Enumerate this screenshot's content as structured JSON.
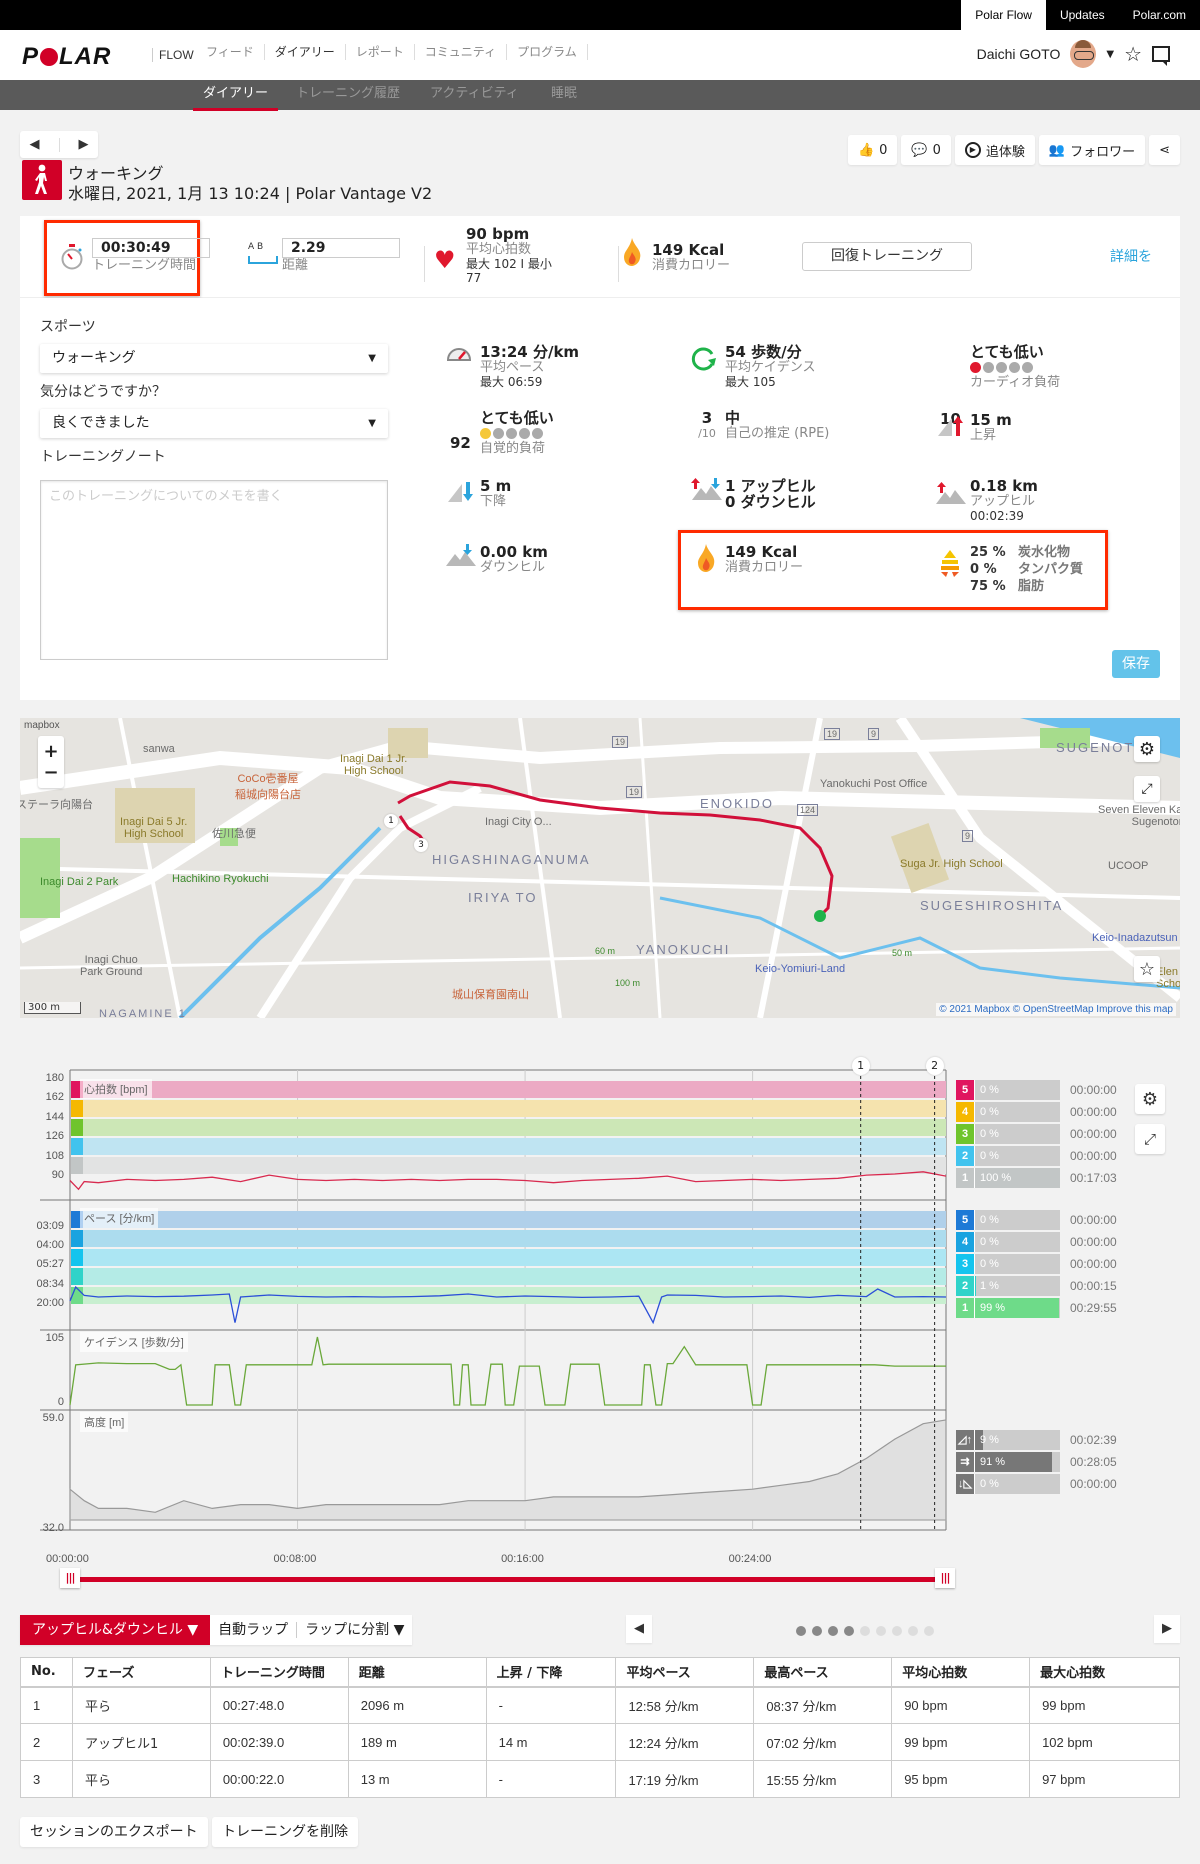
{
  "topbar": {
    "links": [
      "Polar Flow",
      "Updates",
      "Polar.com"
    ],
    "active_index": 0
  },
  "nav": {
    "logo": "POLAR",
    "product": "FLOW",
    "links": [
      "フィード",
      "ダイアリー",
      "レポート",
      "コミュニティ",
      "プログラム"
    ],
    "active_index": 1,
    "user_name": "Daichi GOTO"
  },
  "subnav": {
    "links": [
      "ダイアリー",
      "トレーニング履歴",
      "アクティビティ",
      "睡眠"
    ],
    "active_index": 0
  },
  "session": {
    "sport": "ウォーキング",
    "datetime_device": "水曜日, 2021, 1月 13 10:24 | Polar Vantage V2"
  },
  "actions": {
    "likes": "0",
    "comments": "0",
    "relive": "追体験",
    "followers": "フォロワー"
  },
  "summary": {
    "duration": "00:30:49",
    "duration_label": "トレーニング時間",
    "distance_ab": "A  B",
    "distance": "2.29",
    "distance_label": "距離",
    "hr_avg": "90 bpm",
    "hr_label": "平均心拍数",
    "hr_maxmin": "最大 102 I 最小",
    "hr_min": "77",
    "calories": "149 Kcal",
    "calories_label": "消費カロリー",
    "benefit_button": "回復トレーニング",
    "details_link": "詳細を"
  },
  "form": {
    "sport_label": "スポーツ",
    "sport_value": "ウォーキング",
    "feeling_label": "気分はどうですか？",
    "feeling_value": "良くできました",
    "note_label": "トレーニングノート",
    "note_placeholder": "このトレーニングについてのメモを書く",
    "save": "保存"
  },
  "metrics": {
    "pace": {
      "value": "13:24 分/km",
      "label": "平均ペース",
      "sub": "最大 06:59"
    },
    "cadence": {
      "value": "54 歩数/分",
      "label": "平均ケイデンス",
      "sub": "最大 105"
    },
    "cardio_load": {
      "num": "10",
      "value": "とても低い",
      "label": "カーディオ負荷",
      "level": 1,
      "max": 5,
      "color": "#e0182d"
    },
    "perceived_load": {
      "num": "92",
      "value": "とても低い",
      "label": "自覚的負荷",
      "level": 1,
      "max": 5,
      "color": "#f5c83a"
    },
    "rpe": {
      "num": "3",
      "den": "/10",
      "value": "中",
      "label": "自己の推定 (RPE)"
    },
    "ascent": {
      "value": "15 m",
      "label": "上昇"
    },
    "descent": {
      "value": "5 m",
      "label": "下降"
    },
    "hills": {
      "uphill": "1 アップヒル",
      "downhill": "0 ダウンヒル"
    },
    "uphill_dist": {
      "value": "0.18 km",
      "label": "アップヒル",
      "sub": "00:02:39"
    },
    "downhill_dist": {
      "value": "0.00 km",
      "label": "ダウンヒル"
    },
    "calories": {
      "value": "149 Kcal",
      "label": "消費カロリー"
    },
    "fuel": [
      {
        "pct": "25 %",
        "label": "炭水化物"
      },
      {
        "pct": "0 %",
        "label": "タンパク質"
      },
      {
        "pct": "75 %",
        "label": "脂肪"
      }
    ]
  },
  "map": {
    "brand": "mapbox",
    "scale": "300 m",
    "attribution": "© 2021 Mapbox © OpenStreetMap Improve this map",
    "labels": {
      "higashinaganuma": "HIGASHINAGANUMA",
      "iriyato": "IRIYA TO",
      "enokido": "ENOKIDO",
      "yanokuchi": "YANOKUCHI",
      "sugeshiroshita": "SUGESHIROSHITA",
      "sugenoto": "SUGENOTO",
      "sanwa": "sanwa",
      "inagi_dai1": "Inagi Dai 1 Jr.\nHigh School",
      "inagi_dai5": "Inagi Dai 5 Jr.\nHigh School",
      "coco": "CoCo壱番屋\n稲城向陽台店",
      "sagawa": "佐川急便",
      "inagi_dai2": "Inagi Dai 2 Park",
      "hachikino": "Hachikino Ryokuchi",
      "inagi_chuo": "Inagi Chuo\nPark Ground",
      "shiroyama": "城山保育園南山",
      "inagi_city": "Inagi City O...",
      "yanokuchi_po": "Yanokuchi Post Office",
      "suga_jhs": "Suga Jr. High School",
      "keio_yomiuri": "Keio-Yomiuri-Land",
      "seven_eleven": "Seven Eleven Ka\nSugenotor",
      "ucoop": "UCOOP",
      "keio_inada": "Keio-Inadazutsun",
      "nagamine": "NAGAMINE 1",
      "koyodai": "ステーラ向陽台",
      "e_school": "Elen\nScho",
      "route_19a": "19",
      "route_19b": "19",
      "route_19c": "19",
      "route_9a": "9",
      "route_9b": "9",
      "route_124": "124",
      "m50": "50 m",
      "m100": "100 m",
      "m60": "60 m"
    },
    "lap_markers": [
      "1",
      "3"
    ]
  },
  "chart_data": [
    {
      "type": "line",
      "title": "心拍数 [bpm]",
      "yticks": [
        "180",
        "162",
        "144",
        "126",
        "108",
        "90"
      ],
      "ylim": [
        72,
        180
      ],
      "zones": [
        {
          "zone": "5",
          "pct": 0,
          "pct_label": "0 %",
          "time": "00:00:00",
          "color": "#e0155f",
          "band": "#ecaac4"
        },
        {
          "zone": "4",
          "pct": 0,
          "pct_label": "0 %",
          "time": "00:00:00",
          "color": "#f5b800",
          "band": "#f5e3ae"
        },
        {
          "zone": "3",
          "pct": 0,
          "pct_label": "0 %",
          "time": "00:00:00",
          "color": "#6fc42c",
          "band": "#cce7b6"
        },
        {
          "zone": "2",
          "pct": 0,
          "pct_label": "0 %",
          "time": "00:00:00",
          "color": "#41c3ee",
          "band": "#bfe4f2"
        },
        {
          "zone": "1",
          "pct": 100,
          "pct_label": "100 %",
          "time": "00:17:03",
          "color": "#c2c6c6",
          "band": "#e2e3e3"
        }
      ],
      "series": [
        {
          "name": "heart_rate",
          "color": "#d82a4f",
          "x_min": [
            0,
            0.3,
            0.5,
            1,
            2,
            3,
            4,
            5,
            6,
            7,
            8,
            9,
            10,
            11,
            12,
            13,
            14,
            15,
            16,
            17,
            18,
            19,
            20,
            21,
            22,
            23,
            24,
            25,
            26,
            27,
            28,
            29,
            30,
            30.8
          ],
          "values": [
            88,
            80,
            87,
            86,
            89,
            88,
            89,
            91,
            87,
            93,
            89,
            88,
            89,
            88,
            89,
            88,
            89,
            89,
            88,
            86,
            88,
            89,
            90,
            92,
            87,
            88,
            89,
            88,
            89,
            90,
            93,
            94,
            96,
            92
          ]
        }
      ]
    },
    {
      "type": "line",
      "title": "ペース [分/km]",
      "yticks": [
        "03:09",
        "04:00",
        "05:27",
        "08:34",
        "20:00"
      ],
      "zones": [
        {
          "zone": "5",
          "pct": 0,
          "pct_label": "0 %",
          "time": "00:00:00",
          "color": "#1e7ad6",
          "band": "#b0d0ea"
        },
        {
          "zone": "4",
          "pct": 0,
          "pct_label": "0 %",
          "time": "00:00:00",
          "color": "#1aa3e0",
          "band": "#acdcee"
        },
        {
          "zone": "3",
          "pct": 0,
          "pct_label": "0 %",
          "time": "00:00:00",
          "color": "#14c4ee",
          "band": "#ace6f3"
        },
        {
          "zone": "2",
          "pct": 1,
          "pct_label": "1 %",
          "time": "00:00:15",
          "color": "#2fd3c9",
          "band": "#b4ebe6"
        },
        {
          "zone": "1",
          "pct": 99,
          "pct_label": "99 %",
          "time": "00:29:55",
          "color": "#6edb89",
          "band": "#c8efd0"
        }
      ],
      "series": [
        {
          "name": "pace",
          "color": "#2b4fd8",
          "x_min": [
            0,
            0.2,
            0.5,
            1,
            2,
            3,
            4,
            5,
            5.6,
            5.8,
            6,
            7,
            8,
            9,
            10,
            11,
            12,
            13,
            14,
            15,
            16,
            17,
            18,
            19,
            20,
            20.5,
            20.8,
            21,
            22,
            23,
            24,
            25,
            26,
            27,
            28,
            28.4,
            29,
            30,
            30.8
          ],
          "values_zone_pos": [
            0.9,
            0.2,
            0.62,
            0.7,
            0.65,
            0.68,
            0.66,
            0.6,
            0.55,
            0.98,
            0.7,
            0.6,
            0.67,
            0.7,
            0.68,
            0.7,
            0.68,
            0.64,
            0.55,
            0.7,
            0.65,
            0.68,
            0.72,
            0.7,
            0.66,
            0.98,
            0.7,
            0.6,
            0.62,
            0.7,
            0.68,
            0.65,
            0.72,
            0.62,
            0.68,
            0.3,
            0.7,
            0.68,
            0.7
          ]
        }
      ]
    },
    {
      "type": "line",
      "title": "ケイデンス [歩数/分]",
      "yticks": [
        "105",
        "0"
      ],
      "ylim": [
        0,
        105
      ],
      "series": [
        {
          "name": "cadence",
          "color": "#6aa83a",
          "x_min": [
            0,
            0.2,
            1,
            2,
            3,
            3.5,
            3.7,
            3.9,
            4.1,
            5,
            5.1,
            5.6,
            5.8,
            6,
            6.2,
            8.5,
            8.7,
            8.9,
            9.1,
            13.4,
            13.5,
            13.7,
            13.8,
            14.0,
            14.1,
            14.6,
            14.8,
            15.2,
            15.3,
            15.6,
            15.8,
            16.5,
            16.7,
            17.4,
            17.6,
            18.6,
            18.8,
            20.1,
            20.2,
            20.4,
            20.6,
            20.8,
            21,
            21.2,
            21.6,
            22,
            23.8,
            24,
            24.3,
            24.5,
            25,
            28.3,
            29,
            30.8
          ],
          "values": [
            0,
            62,
            65,
            64,
            64,
            55,
            55,
            62,
            0,
            0,
            62,
            62,
            0,
            0,
            62,
            62,
            105,
            62,
            63,
            63,
            0,
            0,
            62,
            62,
            0,
            0,
            63,
            63,
            0,
            0,
            60,
            60,
            0,
            0,
            63,
            63,
            0,
            0,
            62,
            62,
            0,
            0,
            64,
            64,
            90,
            62,
            62,
            0,
            0,
            62,
            62,
            62,
            60,
            60
          ]
        }
      ]
    },
    {
      "type": "area",
      "title": "高度 [m]",
      "yticks": [
        "59.0",
        "32.0"
      ],
      "ylim": [
        32,
        59
      ],
      "uphill_stats": [
        {
          "icon": "uphill",
          "pct": 9,
          "pct_label": "9 %",
          "time": "00:02:39"
        },
        {
          "icon": "flat",
          "pct": 91,
          "pct_label": "91 %",
          "time": "00:28:05"
        },
        {
          "icon": "downhill",
          "pct": 0,
          "pct_label": "0 %",
          "time": "00:00:00"
        }
      ],
      "series": [
        {
          "name": "altitude",
          "color": "#999999",
          "x_min": [
            0,
            0.5,
            1,
            2,
            3,
            4,
            5,
            6,
            7,
            8,
            9,
            10,
            11,
            12,
            13,
            14,
            15,
            16,
            17,
            18,
            19,
            20,
            21,
            22,
            23,
            24,
            25,
            26,
            27,
            28,
            29,
            30,
            30.8
          ],
          "values": [
            40,
            37,
            35,
            35,
            34,
            37,
            35,
            36,
            36,
            35,
            36,
            36,
            36,
            36,
            36,
            37,
            37,
            37,
            38,
            38,
            38,
            38,
            38.5,
            39,
            39.5,
            40,
            41,
            42,
            44,
            48,
            53,
            57,
            58
          ]
        }
      ]
    }
  ],
  "chart_axis": {
    "x_ticks": [
      "00:00:00",
      "00:08:00",
      "00:16:00",
      "00:24:00"
    ],
    "x_tick_min": [
      0,
      8,
      16,
      24
    ],
    "x_max_min": 30.8,
    "lap_markers": [
      {
        "label": "1",
        "min": 27.8
      },
      {
        "label": "2",
        "min": 30.4
      }
    ]
  },
  "lap_toolbar": {
    "mode": "アップヒル&ダウンヒル",
    "auto_lap": "自動ラップ",
    "split": "ラップに分割",
    "page_dots": 9,
    "page_active": 4
  },
  "laps_table": {
    "headers": [
      "No.",
      "フェーズ",
      "トレーニング時間",
      "距離",
      "上昇 / 下降",
      "平均ペース",
      "最高ペース",
      "平均心拍数",
      "最大心拍数"
    ],
    "rows": [
      [
        "1",
        "平ら",
        "00:27:48.0",
        "2096 m",
        "-",
        "12:58 分/km",
        "08:37 分/km",
        "90 bpm",
        "99 bpm"
      ],
      [
        "2",
        "アップヒル1",
        "00:02:39.0",
        "189 m",
        "14 m",
        "12:24 分/km",
        "07:02 分/km",
        "99 bpm",
        "102 bpm"
      ],
      [
        "3",
        "平ら",
        "00:00:22.0",
        "13 m",
        "-",
        "17:19 分/km",
        "15:55 分/km",
        "95 bpm",
        "97 bpm"
      ]
    ]
  },
  "footer": {
    "export": "セッションのエクスポート",
    "delete": "トレーニングを削除"
  }
}
